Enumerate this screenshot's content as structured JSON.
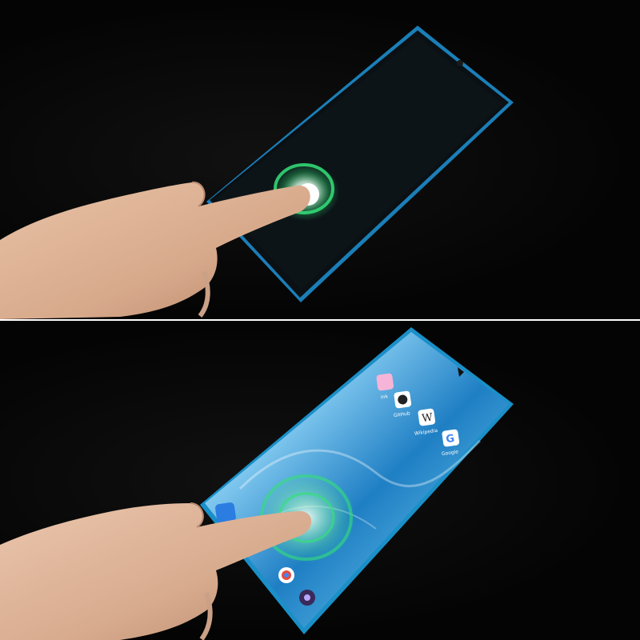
{
  "top_panel": {
    "description_state": "screen-off fingerprint scan"
  },
  "bottom_panel": {
    "apps": [
      {
        "label": "ink",
        "icon": "pink-app-icon"
      },
      {
        "label": "GitHub",
        "icon": "github-icon"
      },
      {
        "label": "Wikipedia",
        "icon": "wikipedia-icon"
      },
      {
        "label": "Google",
        "icon": "google-icon"
      }
    ],
    "wiki_glyph": "W",
    "google_glyph": "G"
  },
  "colors": {
    "phone_frame": "#2a9fd6",
    "fingerprint_ring": "#34e07a",
    "background": "#050505"
  }
}
